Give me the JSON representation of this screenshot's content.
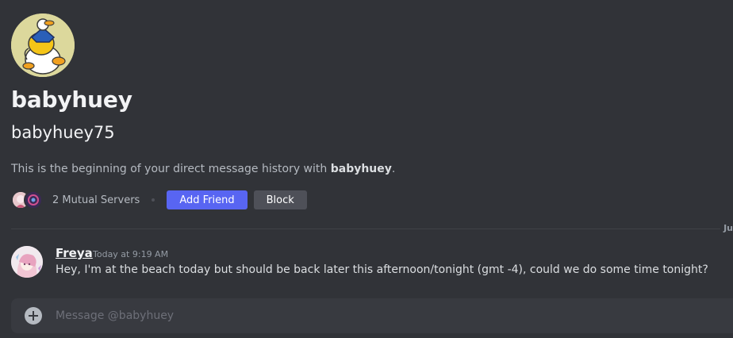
{
  "profile": {
    "display_name": "babyhuey",
    "username": "babyhuey75",
    "intro_prefix": "This is the beginning of your direct message history with ",
    "intro_name": "babyhuey",
    "intro_suffix": ".",
    "mutual_servers": "2 Mutual Servers",
    "add_friend_label": "Add Friend",
    "block_label": "Block"
  },
  "divider": {
    "date_label": "Ju"
  },
  "messages": [
    {
      "author": "Freya",
      "timestamp": "Today at 9:19 AM",
      "text": "Hey, I'm at the beach today but should be back later this afternoon/tonight (gmt -4), could we do some time tonight?"
    }
  ],
  "composer": {
    "placeholder": "Message @babyhuey"
  },
  "colors": {
    "background": "#313338",
    "accent": "#5865f2",
    "secondary_button": "#4e5058",
    "composer": "#383a40"
  },
  "icons": {
    "attach": "plus-circle-icon"
  }
}
